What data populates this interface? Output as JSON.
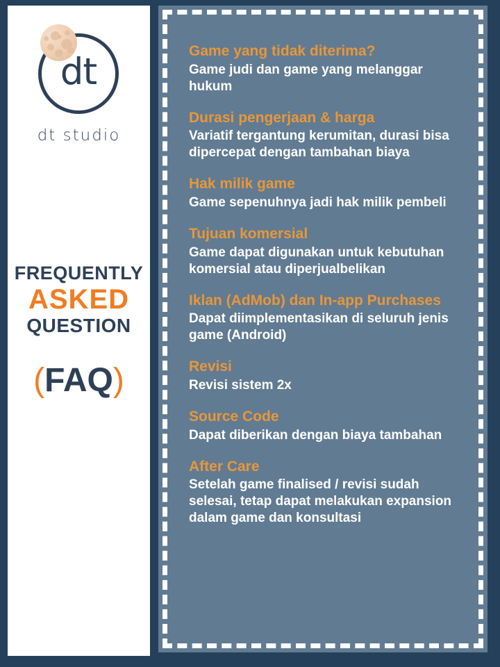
{
  "colors": {
    "navy_frame": "#25405A",
    "slate_panel": "#617B92",
    "white_panel": "#FFFFFF",
    "accent_orange_heading": "#E8973A",
    "accent_orange_title": "#F07D22",
    "navy_text": "#2E4057"
  },
  "brand": {
    "logo_letters": "dt",
    "wordmark": "dt studio",
    "moon_icon": "moon-icon",
    "circle_icon": "circle-outline-icon"
  },
  "title": {
    "line1": "FREQUENTLY",
    "line2": "ASKED",
    "line3": "QUESTION",
    "abbrev_open": "(",
    "abbrev_text": "FAQ",
    "abbrev_close": ")"
  },
  "faq": {
    "items": [
      {
        "question": "Game yang tidak diterima?",
        "answer": "Game judi dan game yang melanggar hukum"
      },
      {
        "question": "Durasi pengerjaan & harga",
        "answer": "Variatif tergantung kerumitan, durasi bisa dipercepat dengan tambahan biaya"
      },
      {
        "question": "Hak milik game",
        "answer": "Game sepenuhnya jadi hak milik pembeli"
      },
      {
        "question": "Tujuan komersial",
        "answer": "Game dapat digunakan untuk kebutuhan komersial atau diperjualbelikan"
      },
      {
        "question": "Iklan (AdMob) dan In-app Purchases",
        "answer": "Dapat diimplementasikan di seluruh jenis game (Android)"
      },
      {
        "question": "Revisi",
        "answer": "Revisi sistem 2x"
      },
      {
        "question": "Source Code",
        "answer": "Dapat diberikan dengan biaya tambahan"
      },
      {
        "question": "After Care",
        "answer": "Setelah game finalised / revisi sudah selesai, tetap dapat melakukan expansion dalam game dan konsultasi"
      }
    ]
  }
}
